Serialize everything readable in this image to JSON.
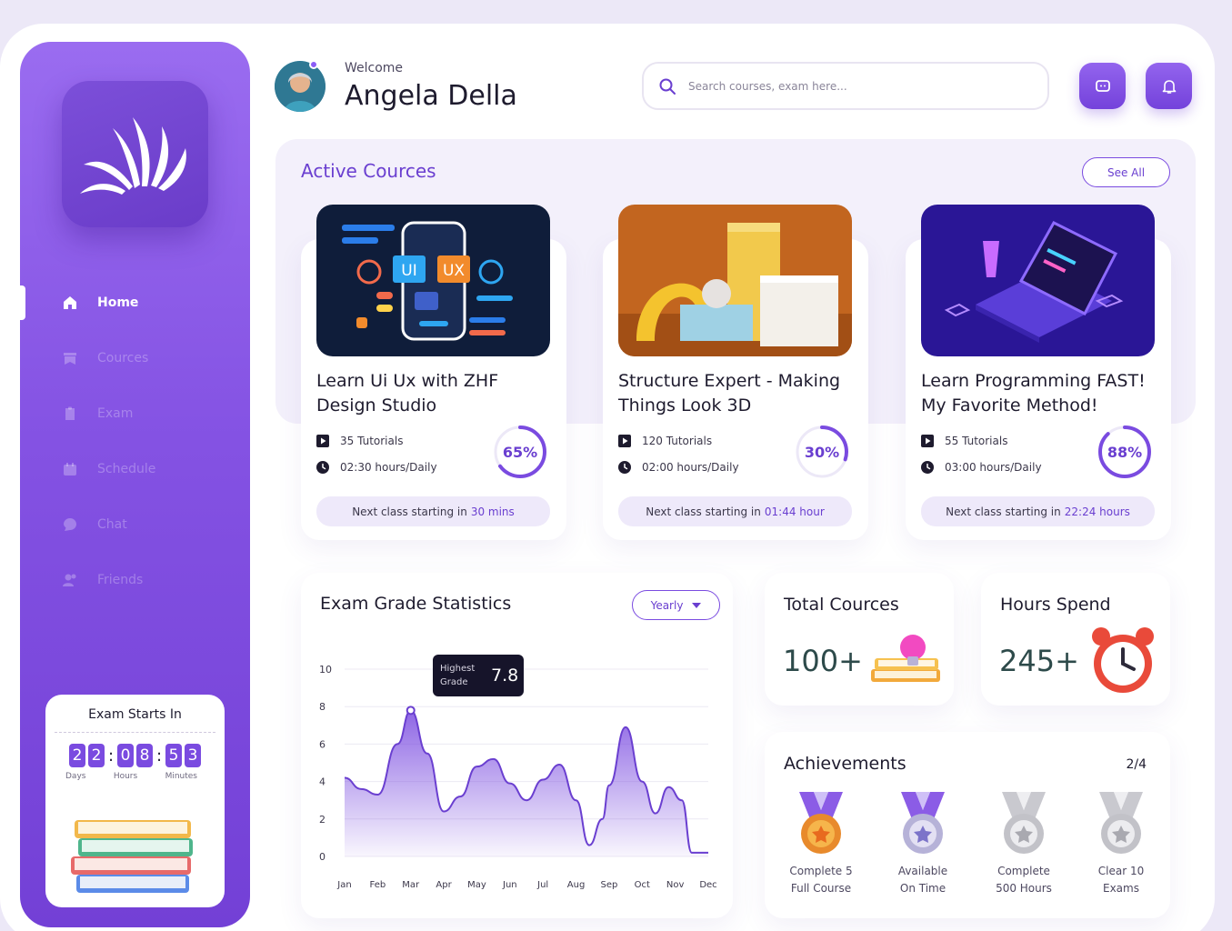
{
  "sidebar": {
    "nav": [
      {
        "label": "Home",
        "icon": "home-icon",
        "active": true
      },
      {
        "label": "Cources",
        "icon": "courses-icon",
        "active": false
      },
      {
        "label": "Exam",
        "icon": "exam-icon",
        "active": false
      },
      {
        "label": "Schedule",
        "icon": "calendar-icon",
        "active": false
      },
      {
        "label": "Chat",
        "icon": "chat-icon",
        "active": false
      },
      {
        "label": "Friends",
        "icon": "friends-icon",
        "active": false
      }
    ],
    "exam_card": {
      "title": "Exam Starts In",
      "days": [
        "2",
        "2"
      ],
      "hours": [
        "0",
        "8"
      ],
      "minutes": [
        "5",
        "3"
      ],
      "labels": [
        "Days",
        "Hours",
        "Minutes"
      ]
    }
  },
  "header": {
    "welcome": "Welcome",
    "username": "Angela Della",
    "search_placeholder": "Search courses, exam here...",
    "buttons": [
      "chat-bubble-icon",
      "bell-icon"
    ]
  },
  "active_courses": {
    "title": "Active Cources",
    "see_all": "See All",
    "items": [
      {
        "title": "Learn Ui Ux with ZHF Design Studio",
        "tutorials": "35 Tutorials",
        "hours": "02:30 hours/Daily",
        "progress": 65,
        "progress_label": "65%",
        "next_prefix": "Next class starting in",
        "next_time": "30 mins"
      },
      {
        "title": "Structure Expert - Making Things Look 3D",
        "tutorials": "120 Tutorials",
        "hours": "02:00 hours/Daily",
        "progress": 30,
        "progress_label": "30%",
        "next_prefix": "Next class starting in",
        "next_time": "01:44 hour"
      },
      {
        "title": "Learn Programming FAST! My Favorite Method!",
        "tutorials": "55 Tutorials",
        "hours": "03:00 hours/Daily",
        "progress": 88,
        "progress_label": "88%",
        "next_prefix": "Next class starting in",
        "next_time": "22:24 hours"
      }
    ]
  },
  "exam_stats": {
    "title": "Exam Grade Statistics",
    "period": "Yearly",
    "tooltip_label": "Highest Grade",
    "tooltip_value": "7.8"
  },
  "chart_data": {
    "type": "area",
    "title": "Exam Grade Statistics",
    "categories": [
      "Jan",
      "Feb",
      "Mar",
      "Apr",
      "May",
      "Jun",
      "Jul",
      "Aug",
      "Sep",
      "Oct",
      "Nov",
      "Dec"
    ],
    "x": [
      0,
      0.5,
      1,
      1.6,
      2,
      2.5,
      3,
      3.5,
      4,
      4.5,
      5,
      5.5,
      6,
      6.5,
      7,
      7.4,
      7.8,
      8,
      8.5,
      9,
      9.4,
      9.8,
      10.2,
      10.5,
      10.8,
      11
    ],
    "values": [
      4.2,
      3.6,
      3.3,
      6.0,
      7.8,
      5.5,
      2.4,
      3.2,
      4.8,
      5.2,
      3.9,
      3.0,
      4.1,
      4.9,
      3.0,
      0.6,
      2.0,
      3.8,
      6.9,
      4.0,
      2.3,
      3.7,
      3.0,
      0.2,
      0.2,
      0.2
    ],
    "y_ticks": [
      0,
      2,
      4,
      6,
      8,
      10
    ],
    "ylim": [
      0,
      10
    ],
    "grid": true,
    "accent": "#7a4be0"
  },
  "total_courses": {
    "title": "Total Cources",
    "value": "100+"
  },
  "hours_spend": {
    "title": "Hours Spend",
    "value": "245+"
  },
  "achievements": {
    "title": "Achievements",
    "count": "2/4",
    "items": [
      {
        "line1": "Complete 5",
        "line2": "Full Course",
        "style": "gold"
      },
      {
        "line1": "Available",
        "line2": "On Time",
        "style": "purple"
      },
      {
        "line1": "Complete",
        "line2": "500 Hours",
        "style": "silver"
      },
      {
        "line1": "Clear 10",
        "line2": "Exams",
        "style": "silver"
      }
    ]
  },
  "colors": {
    "accent": "#7a4be0",
    "sidebar_top": "#9a6cf0",
    "sidebar_bottom": "#7340d6",
    "panel": "#f3f0fb"
  }
}
